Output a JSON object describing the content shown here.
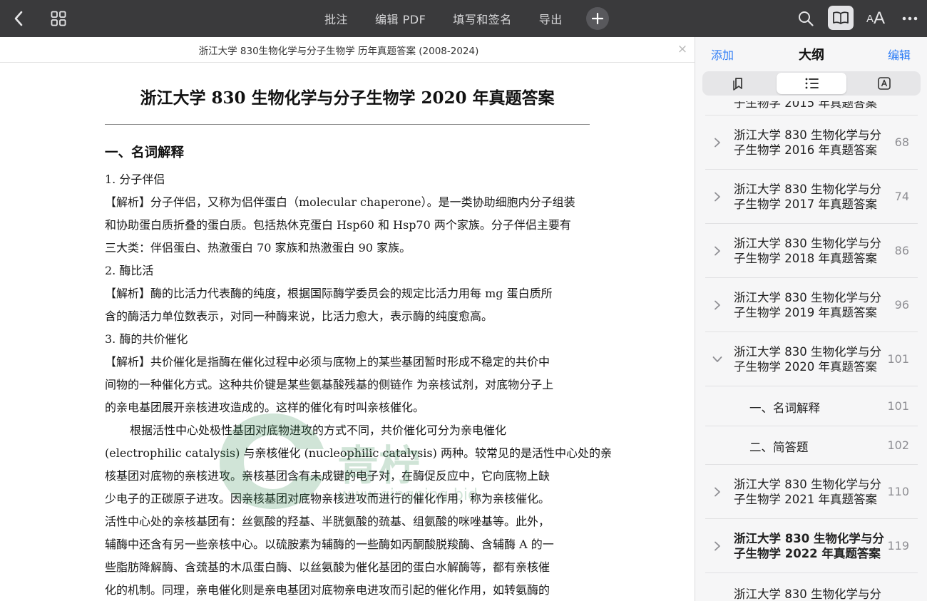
{
  "toolbar": {
    "menu": [
      "批注",
      "编辑 PDF",
      "填写和签名",
      "导出"
    ],
    "font_small": "A",
    "font_big": "A",
    "icons": [
      "back-chevron-icon",
      "grid-icon",
      "plus-icon",
      "search-icon",
      "book-icon",
      "text-size-icon",
      "more-icon"
    ]
  },
  "document": {
    "tab_title": "浙江大学 830生物化学与分子生物学 历年真题答案 (2008-2024)",
    "close_symbol": "×",
    "page_title": "浙江大学 830 生物化学与分子生物学 2020 年真题答案",
    "section_heading": "一、名词解释",
    "lines": [
      "1. 分子伴侣",
      "【解析】分子伴侣，又称为侣伴蛋白（molecular chaperone）。是一类协助细胞内分子组装",
      "和协助蛋白质折叠的蛋白质。包括热休克蛋白 Hsp60 和 Hsp70 两个家族。分子伴侣主要有",
      "三大类：伴侣蛋白、热激蛋白 70 家族和热激蛋白 90 家族。",
      "2. 酶比活",
      "【解析】酶的比活力代表酶的纯度，根据国际酶学委员会的规定比活力用每 mg 蛋白质所",
      "含的酶活力单位数表示，对同一种酶来说，比活力愈大，表示酶的纯度愈高。",
      "3. 酶的共价催化",
      "【解析】共价催化是指酶在催化过程中必须与底物上的某些基团暂时形成不稳定的共价中",
      "间物的一种催化方式。这种共价键是某些氨基酸残基的侧链作 为亲核试剂，对底物分子上",
      "的亲电基团展开亲核进攻造成的。这样的催化有时叫亲核催化。",
      "根据活性中心处极性基团对底物进攻的方式不同，共价催化可分为亲电催化",
      "(electrophilic catalysis) 与亲核催化 (nucleophilic catalysis) 两种。较常见的是活性中心处的亲",
      "核基团对底物的亲核进攻。亲核基团含有未成键的电子对，在酶促反应中，它向底物上缺",
      "少电子的正碳原子进攻。因亲核基团对底物亲核进攻而进行的催化作用，称为亲核催化。",
      "活性中心处的亲核基团有：丝氨酸的羟基、半胱氨酸的巯基、组氨酸的咪唑基等。此外，",
      "辅酶中还含有另一些亲核中心。以硫胺素为辅酶的一些酶如丙酮酸脱羧酶、含辅酶 A 的一",
      "些脂肪降解酶、含巯基的木瓜蛋白酶、以丝氨酸为催化基团的蛋白水解酶等，都有亲核催",
      "化的机制。同理，亲电催化则是亲电基团对底物亲电进攻而引起的催化作用，如转氨酶的"
    ],
    "watermark": {
      "text": "青柠",
      "sub": "www.qingning.bid"
    }
  },
  "sidebar": {
    "add_label": "添加",
    "title": "大纲",
    "edit_label": "编辑",
    "partial_top": "子生物学 2015 年真题答案",
    "items": [
      {
        "line1": "浙江大学 830 生物化学与分",
        "line2": "子生物学 2016 年真题答案",
        "page": "68"
      },
      {
        "line1": "浙江大学 830 生物化学与分",
        "line2": "子生物学 2017 年真题答案",
        "page": "74"
      },
      {
        "line1": "浙江大学 830 生物化学与分",
        "line2": "子生物学 2018 年真题答案",
        "page": "86"
      },
      {
        "line1": "浙江大学 830 生物化学与分",
        "line2": "子生物学 2019 年真题答案",
        "page": "96"
      },
      {
        "line1": "浙江大学 830 生物化学与分",
        "line2": "子生物学 2020 年真题答案",
        "page": "101"
      },
      {
        "line1": "浙江大学 830 生物化学与分",
        "line2": "子生物学 2021 年真题答案",
        "page": "110"
      },
      {
        "line1": "浙江大学 830 生物化学与分",
        "line2": "子生物学 2022 年真题答案",
        "page": "119"
      }
    ],
    "subitems": [
      {
        "label": "一、名词解释",
        "page": "101"
      },
      {
        "label": "二、简答题",
        "page": "102"
      }
    ],
    "partial_bottom": "浙江大学 830 生物化学与分"
  }
}
